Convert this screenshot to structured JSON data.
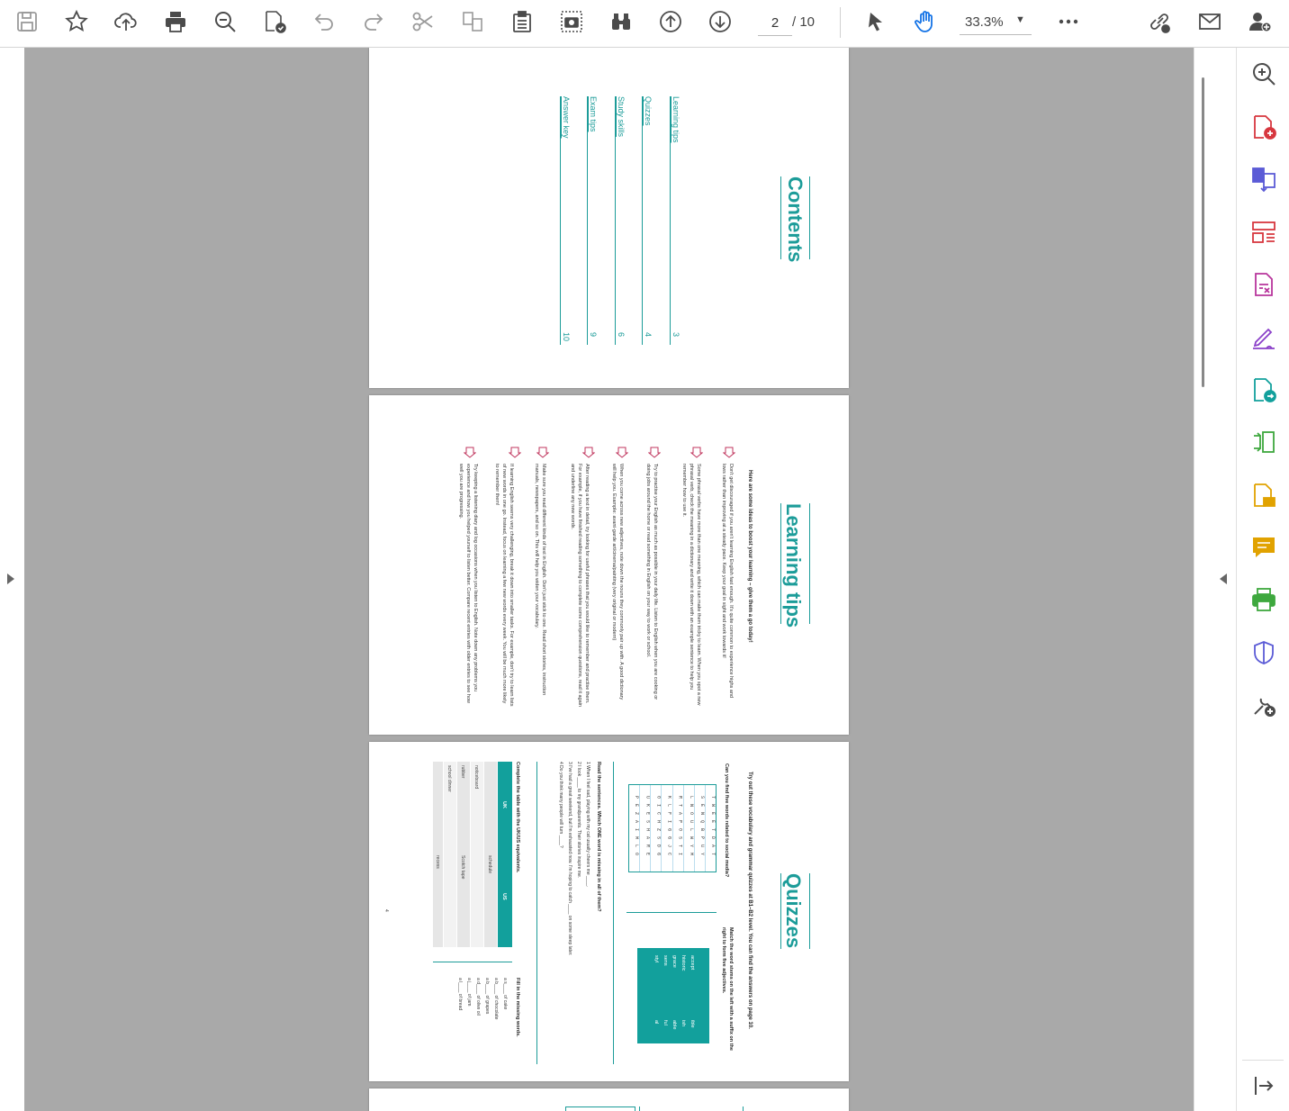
{
  "toolbar": {
    "tools": [
      "save-icon",
      "bookmark-star-icon",
      "cloud-upload-icon",
      "print-icon",
      "zoom-search-icon",
      "text-recognition-icon",
      "undo-icon",
      "redo-icon",
      "cut-icon",
      "compare-icon",
      "clipboard-icon",
      "snapshot-camera-icon",
      "find-binoculars-icon",
      "previous-page-icon",
      "next-page-icon"
    ],
    "current_page": "2",
    "total_pages": "/ 10",
    "zoom": "33.3%",
    "right_tools": [
      "select-pointer-icon",
      "hand-tool-icon",
      "more-icon",
      "share-link-icon",
      "email-icon",
      "add-user-icon"
    ]
  },
  "right_panel": [
    "zoom-in-icon",
    "create-pdf-icon",
    "combine-files-icon",
    "organize-pages-icon",
    "export-pdf-icon",
    "fill-sign-icon",
    "send-for-signature-icon",
    "edit-pdf-icon",
    "request-signatures-icon",
    "comment-icon",
    "print-production-icon",
    "protect-icon",
    "more-tools-icon",
    "collapse-panel-icon"
  ],
  "colors": {
    "accent": "#1c9c99",
    "arrow": "#c0355d",
    "viewer_bg": "#a9a9a9"
  },
  "contents_page": {
    "title": "Contents",
    "items": [
      {
        "label": "Learning tips",
        "page": "3"
      },
      {
        "label": "Quizzes",
        "page": "4"
      },
      {
        "label": "Study skills",
        "page": "6"
      },
      {
        "label": "Exam tips",
        "page": "9"
      },
      {
        "label": "Answer key",
        "page": "10"
      }
    ]
  },
  "tips_page": {
    "title": "Learning tips",
    "intro": "Here are some ideas to boost your learning – give them a go today!",
    "tips": [
      "Don't get discouraged if you aren't learning English fast enough. It's quite common to experience highs and lows rather than improving at a steady pace. Keep your goal in sight and work towards it!",
      "Some phrasal verbs have more than one meaning, which can make them tricky to learn. When you spot a new phrasal verb, check the meaning in a dictionary and write it down with an example sentence to help you remember how to use it.",
      "Try to practise your English as much as possible in your daily life. Listen to English when you are cooking or doing jobs around the home or read something in English on your way to work or school.",
      "When you come across new adjectives, note down the nouns they commonly pair up with. A good dictionary will help you. Example: avant-garde art/cinema/painting (very original or modern)",
      "After reading a text in detail, try looking for useful phrases that you would like to remember and practise them. For example, if you have finished reading something to complete some comprehension questions, read it again and underline any new words.",
      "Make sure you read different kinds of text in English. Don't just stick to one. Read short stories, instruction manuals, newspapers, and so on. This will help you widen your vocabulary.",
      "If learning English seems very challenging, break it down into smaller tasks. For example, don't try to learn lists of new words in one go. Instead, focus on learning a few new words every week. You will be much more likely to remember them!",
      "Try keeping a listening diary and log occasions when you listen to English. Note down any problems you experience and how you helped yourself to listen better. Compare recent entries with older entries to see how well you are progressing."
    ]
  },
  "quiz_page": {
    "title": "Quizzes",
    "intro": "Try out these vocabulary and grammar quizzes at B1–B2 level. You can find the answers on page 10.",
    "wordsearch_q": "Can you find five words related to social media?",
    "wordsearch": [
      "TWEETDAT",
      "SENQBPUY",
      "LNOULWYM",
      "RTAPOSTI",
      "KLFIGGJC",
      "OICHZSDG",
      "UKESHARE",
      "PEZAIMLO"
    ],
    "match_q": "Match the word stems on the left with a suffix on the right to form five adjectives.",
    "stems": [
      "accept",
      "historic",
      "grace",
      "sens",
      "styl"
    ],
    "suffixes": [
      "ible",
      "ish",
      "able",
      "ful",
      "al"
    ],
    "missing_q": "Read the sentences. Which ONE word is missing in all of them?",
    "sentences": [
      "1 When I feel sad, playing with my cat usually cheers me ____.",
      "2 I look ____ to my grandparents. Their stories inspire me.",
      "3 I've had a great weekend, but I'm exhausted now. I'm hoping to catch ____ on some sleep later.",
      "4 Do you think many people will turn ____?"
    ],
    "table_q": "Complete the table with the UK/US equivalents.",
    "table_headers": [
      "UK",
      "US"
    ],
    "table_rows": [
      [
        "",
        "schedule"
      ],
      [
        "noticeboard",
        ""
      ],
      [
        "rubber",
        "Scotch tape"
      ],
      [
        "school dinner",
        ""
      ],
      [
        "",
        "recess"
      ]
    ],
    "fill_q": "Fill in the missing words.",
    "fill": [
      "a s____ of cake",
      "a b____ of chocolate",
      "a b____ of grapes",
      "a d____ of olive oil",
      "a j____ of jam",
      "a l____ of bread"
    ],
    "page_number": "4"
  }
}
